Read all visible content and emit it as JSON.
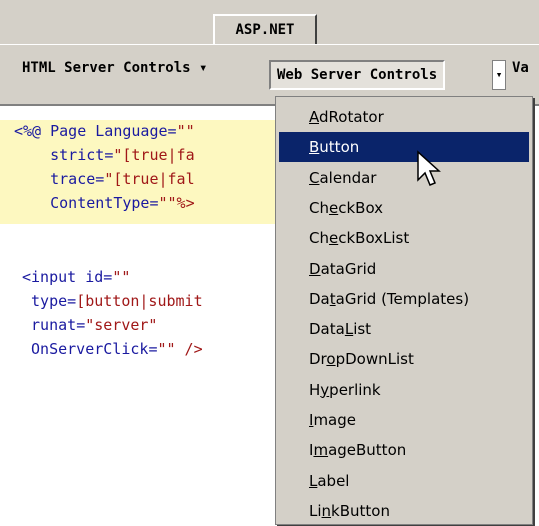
{
  "tabs": {
    "active": "ASP.NET"
  },
  "toolbar": {
    "html_controls": "HTML Server Controls",
    "web_controls": "Web Server Controls",
    "validation_prefix": "Va",
    "dropdown_arrow": "▾"
  },
  "code": {
    "page_directive": [
      {
        "prefix": "<%@ Page ",
        "attr": "Language",
        "eq": "=",
        "value": "\"\""
      },
      {
        "prefix": "    ",
        "attr": "strict",
        "eq": "=",
        "value": "\"[true|fa"
      },
      {
        "prefix": "    ",
        "attr": "trace",
        "eq": "=",
        "value": "\"[true|fal"
      },
      {
        "prefix": "    ",
        "attr": "ContentType",
        "eq": "=",
        "value": "\"\"%>"
      }
    ],
    "input_block": [
      {
        "prefix": "<input ",
        "attr": "id",
        "eq": "=",
        "value": "\"\""
      },
      {
        "prefix": " ",
        "attr": "type",
        "eq": "=",
        "value": "[button|submit"
      },
      {
        "prefix": " ",
        "attr": "runat",
        "eq": "=",
        "value": "\"server\""
      },
      {
        "prefix": " ",
        "attr": "OnServerClick",
        "eq": "=",
        "value": "\"\" />"
      }
    ]
  },
  "menu": {
    "items": [
      {
        "before": "",
        "key": "A",
        "after": "dRotator"
      },
      {
        "before": "",
        "key": "B",
        "after": "utton"
      },
      {
        "before": "",
        "key": "C",
        "after": "alendar"
      },
      {
        "before": "Ch",
        "key": "e",
        "after": "ckBox"
      },
      {
        "before": "Ch",
        "key": "e",
        "after": "ckBoxList"
      },
      {
        "before": "",
        "key": "D",
        "after": "ataGrid"
      },
      {
        "before": "Da",
        "key": "t",
        "after": "aGrid (Templates)"
      },
      {
        "before": "Data",
        "key": "L",
        "after": "ist"
      },
      {
        "before": "Dr",
        "key": "o",
        "after": "pDownList"
      },
      {
        "before": "H",
        "key": "y",
        "after": "perlink"
      },
      {
        "before": "",
        "key": "I",
        "after": "mage"
      },
      {
        "before": "I",
        "key": "m",
        "after": "ageButton"
      },
      {
        "before": "",
        "key": "L",
        "after": "abel"
      },
      {
        "before": "Li",
        "key": "n",
        "after": "kButton"
      }
    ],
    "selected_index": 1
  },
  "colors": {
    "chrome": "#d4d0c8",
    "selection": "#0a246a",
    "code_highlight": "#fdf8c0",
    "code_text": "#1a1aa0",
    "code_value": "#a01818"
  }
}
